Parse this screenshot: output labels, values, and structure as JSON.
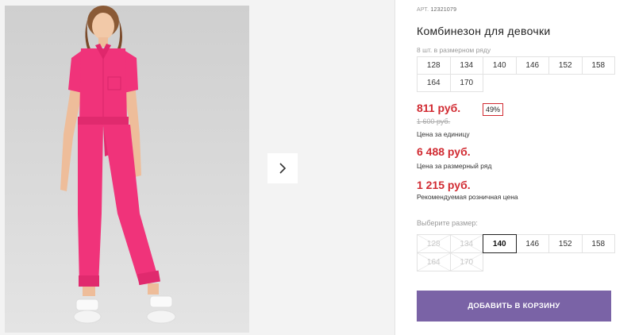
{
  "product": {
    "art_label": "АРТ.",
    "art_number": "12321079",
    "title": "Комбинезон для девочки",
    "qty_note": "8 шт. в размерном ряду",
    "sizes_row": [
      "128",
      "134",
      "140",
      "146",
      "152",
      "158",
      "164",
      "170"
    ]
  },
  "pricing": {
    "price": "811 руб.",
    "discount": "49%",
    "old_price": "1 600 руб.",
    "unit_label": "Цена за единицу",
    "row_price": "6 488 руб.",
    "row_label": "Цена за размерный ряд",
    "retail_price": "1 215 руб.",
    "retail_label": "Рекомендуемая розничная цена",
    "accent_color": "#d12b32"
  },
  "size_picker": {
    "label": "Выберите размер:",
    "options": [
      {
        "value": "128",
        "state": "disabled"
      },
      {
        "value": "134",
        "state": "disabled"
      },
      {
        "value": "140",
        "state": "selected"
      },
      {
        "value": "146",
        "state": "available"
      },
      {
        "value": "152",
        "state": "available"
      },
      {
        "value": "158",
        "state": "available"
      },
      {
        "value": "164",
        "state": "disabled"
      },
      {
        "value": "170",
        "state": "disabled"
      }
    ]
  },
  "cart": {
    "button_label": "ДОБАВИТЬ В КОРЗИНУ",
    "button_color": "#7a63a6"
  },
  "gallery": {
    "next_icon": "chevron-right-icon",
    "garment_color": "#f0337a"
  }
}
